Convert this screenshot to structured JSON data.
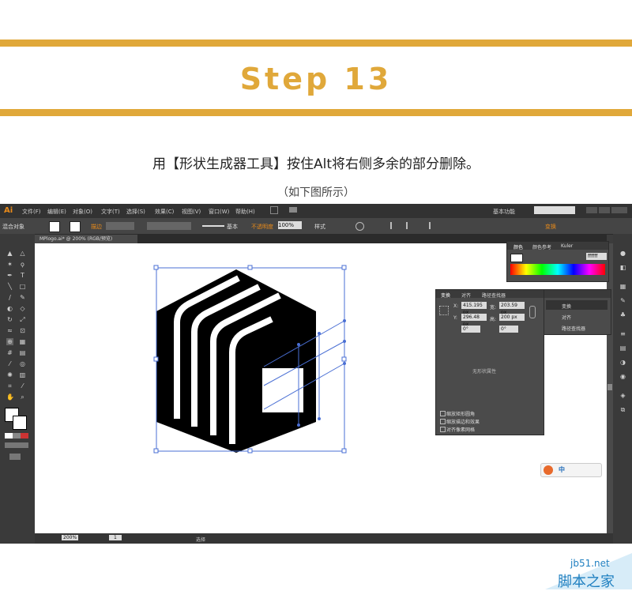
{
  "banner": {
    "title": "Step 13",
    "accent": "#e0a83a"
  },
  "instruction": "用【形状生成器工具】按住Alt将右侧多余的部分删除。",
  "subcaption": "（如下图所示）",
  "app": {
    "logo": "Ai",
    "menu": [
      "文件(F)",
      "编辑(E)",
      "对象(O)",
      "文字(T)",
      "选择(S)",
      "效果(C)",
      "视图(V)",
      "窗口(W)",
      "帮助(H)"
    ],
    "workspace": "基本功能",
    "control": {
      "object_type": "混合对象",
      "stroke_label": "描边",
      "stroke_style": "基本",
      "opacity_label": "不透明度",
      "opacity_value": "100%",
      "style_label": "样式",
      "transform_link": "变换"
    },
    "document_tab": "MPlogo.ai* @ 200% (RGB/预览)",
    "status": {
      "zoom": "200%",
      "page": "1",
      "tool": "选择"
    }
  },
  "color_panel": {
    "tabs": [
      "颜色",
      "颜色参考",
      "Kuler"
    ],
    "hex": "ffffff"
  },
  "transform_panel": {
    "tabs": [
      "变换",
      "对齐",
      "路径查找器"
    ],
    "x_label": "X:",
    "x": "415.195 px",
    "y_label": "Y:",
    "y": "296.48 px",
    "w_label": "宽:",
    "w": "203.59 px",
    "h_label": "高:",
    "h": "200 px",
    "angle": "0°",
    "shear": "0°",
    "no_shape": "无形状属性",
    "options": [
      "缩放矩形圆角",
      "缩放描边和效果",
      "对齐像素网格"
    ]
  },
  "mini_panel": {
    "items": [
      "变换",
      "对齐",
      "路径查找器"
    ]
  },
  "ime": {
    "text": "中"
  },
  "watermark": {
    "url": "jb51.net",
    "name": "脚本之家"
  }
}
